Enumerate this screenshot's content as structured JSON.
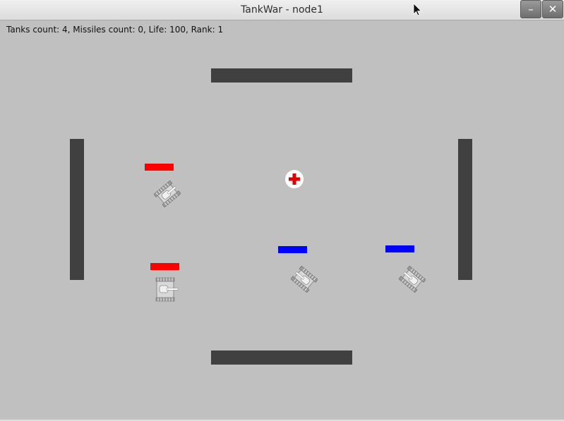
{
  "window": {
    "title": "TankWar - node1",
    "minimize_symbol": "–",
    "close_symbol": "✕"
  },
  "hud": {
    "status": "Tanks count: 4, Missiles count: 0, Life: 100, Rank: 1"
  },
  "colors": {
    "background": "#c0c0c0",
    "wall": "#404040",
    "team_red": "#ff0000",
    "team_blue": "#0000ff",
    "medkit_cross": "#e00000"
  },
  "scene": {
    "walls": [
      {
        "name": "wall-top",
        "orientation": "horizontal"
      },
      {
        "name": "wall-bottom",
        "orientation": "horizontal"
      },
      {
        "name": "wall-left",
        "orientation": "vertical"
      },
      {
        "name": "wall-right",
        "orientation": "vertical"
      }
    ],
    "tanks": [
      {
        "team": "red",
        "health_bar": "full",
        "direction": "diagonal"
      },
      {
        "team": "red",
        "health_bar": "full",
        "direction": "right"
      },
      {
        "team": "blue",
        "health_bar": "full",
        "direction": "diagonal"
      },
      {
        "team": "blue",
        "health_bar": "full",
        "direction": "diagonal"
      }
    ],
    "items": [
      {
        "type": "medkit-icon"
      }
    ]
  }
}
